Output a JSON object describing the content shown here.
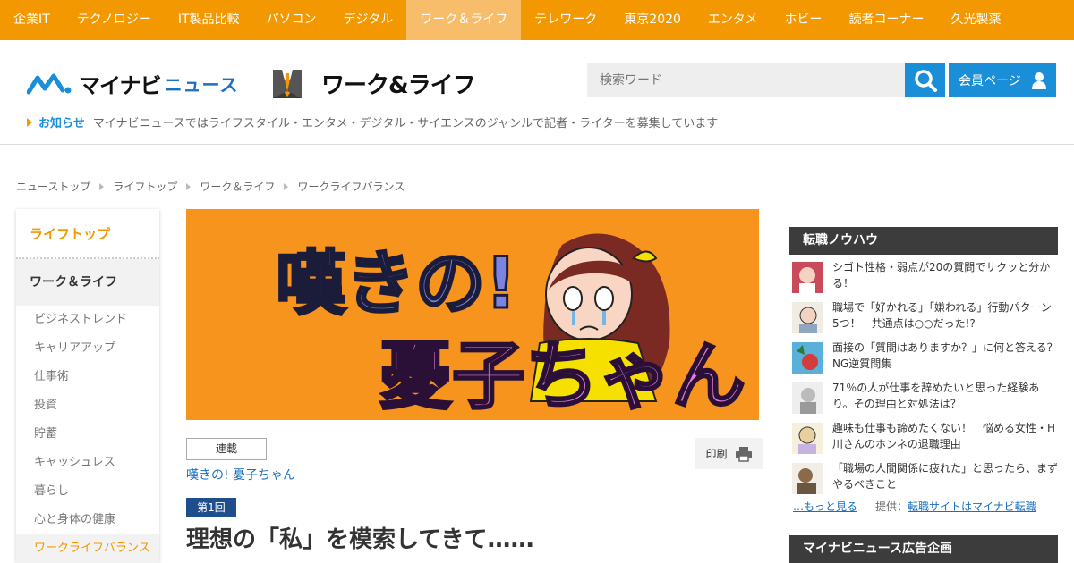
{
  "topnav": {
    "items": [
      "企業IT",
      "テクノロジー",
      "IT製品比較",
      "パソコン",
      "デジタル",
      "ワーク＆ライフ",
      "テレワーク",
      "東京2020",
      "エンタメ",
      "ホビー",
      "読者コーナー",
      "久光製薬"
    ],
    "active_index": 5
  },
  "header": {
    "brand_main": "マイナビ",
    "brand_sub": "ニュース",
    "section_title": "ワーク&ライフ",
    "search_placeholder": "検索ワード",
    "member_label": "会員ページ"
  },
  "notice": {
    "label": "お知らせ",
    "text": "マイナビニュースではライフスタイル・エンタメ・デジタル・サイエンスのジャンルで記者・ライターを募集しています"
  },
  "breadcrumb": [
    "ニューストップ",
    "ライフトップ",
    "ワーク＆ライフ",
    "ワークライフバランス"
  ],
  "sidebar": {
    "top_label": "ライフトップ",
    "category_label": "ワーク＆ライフ",
    "items": [
      "ビジネストレンド",
      "キャリアアップ",
      "仕事術",
      "投資",
      "貯蓄",
      "キャッシュレス",
      "暮らし",
      "心と身体の健康",
      "ワークライフバランス"
    ],
    "active_index": 8
  },
  "article": {
    "hero_title_line1": "嘆きの!",
    "hero_title_line2": "憂子ちゃん",
    "tag": "連載",
    "series_title": "嘆きの! 憂子ちゃん",
    "print_label": "印刷",
    "episode": "第1回",
    "headline": "理想の「私」を模索してきて……"
  },
  "right_column": {
    "heading": "転職ノウハウ",
    "items": [
      {
        "text": "シゴト性格・弱点が20の質問でサクッと分かる！"
      },
      {
        "text": "職場で「好かれる」「嫌われる」行動パターン5つ！　共通点は○○だった!?"
      },
      {
        "text": "面接の「質問はありますか？」に何と答える？　NG逆質問集"
      },
      {
        "text": "71％の人が仕事を辞めたいと思った経験あり。その理由と対処法は？"
      },
      {
        "text": "趣味も仕事も諦めたくない！　悩める女性・H川さんのホンネの退職理由"
      },
      {
        "text": "「職場の人間関係に疲れた」と思ったら、まずやるべきこと"
      }
    ],
    "more_label": "…もっと見る",
    "provider_label": "提供：",
    "provider_link": "転職サイトはマイナビ転職",
    "ad_heading": "マイナビニュース広告企画"
  },
  "colors": {
    "accent": "#f39800",
    "brand_blue": "#1a8fd8",
    "dark_heading": "#3c3c3c"
  }
}
